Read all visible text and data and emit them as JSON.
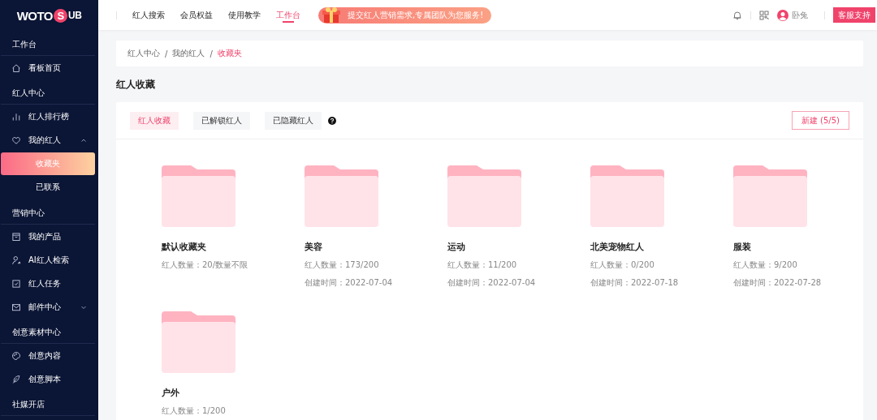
{
  "logo": {
    "parts": [
      "WOTO",
      "S",
      "UB"
    ]
  },
  "sidebar": {
    "groups": [
      {
        "title": "工作台",
        "items": [
          {
            "label": "看板首页"
          }
        ]
      },
      {
        "title": "红人中心",
        "items": [
          {
            "label": "红人排行榜"
          },
          {
            "label": "我的红人",
            "expanded": true,
            "children": [
              {
                "label": "收藏夹",
                "selected": true
              },
              {
                "label": "已联系",
                "selected": false
              }
            ]
          }
        ]
      },
      {
        "title": "营销中心",
        "items": [
          {
            "label": "我的产品"
          },
          {
            "label": "AI红人检索"
          },
          {
            "label": "红人任务"
          },
          {
            "label": "邮件中心",
            "expanded": false
          }
        ]
      },
      {
        "title": "创意素材中心",
        "items": [
          {
            "label": "创意内容"
          },
          {
            "label": "创意脚本"
          }
        ]
      },
      {
        "title": "社媒开店"
      }
    ]
  },
  "topnav": {
    "items": [
      {
        "label": "红人搜索",
        "selected": false
      },
      {
        "label": "会员权益",
        "selected": false
      },
      {
        "label": "使用教学",
        "selected": false
      },
      {
        "label": "工作台",
        "selected": true
      }
    ],
    "banner": "提交红人营销需求,专属团队为您服务!",
    "user": "卧兔",
    "support_button": "客服支持"
  },
  "breadcrumb": [
    {
      "kind": "link",
      "label": "红人中心",
      "current": false
    },
    {
      "kind": "separator",
      "label": "/"
    },
    {
      "kind": "link",
      "label": "我的红人",
      "current": false
    },
    {
      "kind": "separator",
      "label": "/"
    },
    {
      "kind": "link",
      "label": "收藏夹",
      "current": true
    }
  ],
  "page_title": "红人收藏",
  "tabs": [
    {
      "label": "红人收藏",
      "selected": true
    },
    {
      "label": "已解锁红人",
      "selected": false
    },
    {
      "label": "已隐藏红人",
      "selected": false
    }
  ],
  "new_button": "新建 (5/5)",
  "folders": [
    {
      "name": "默认收藏夹",
      "count": "红人数量：20/数量不限"
    },
    {
      "name": "美容",
      "count": "红人数量：173/200",
      "created": "创建时间：2022-07-04"
    },
    {
      "name": "运动",
      "count": "红人数量：11/200",
      "created": "创建时间：2022-07-04"
    },
    {
      "name": "北美宠物红人",
      "count": "红人数量：0/200",
      "created": "创建时间：2022-07-18"
    },
    {
      "name": "服装",
      "count": "红人数量：9/200",
      "created": "创建时间：2022-07-28"
    },
    {
      "name": "户外",
      "count": "红人数量：1/200"
    }
  ]
}
